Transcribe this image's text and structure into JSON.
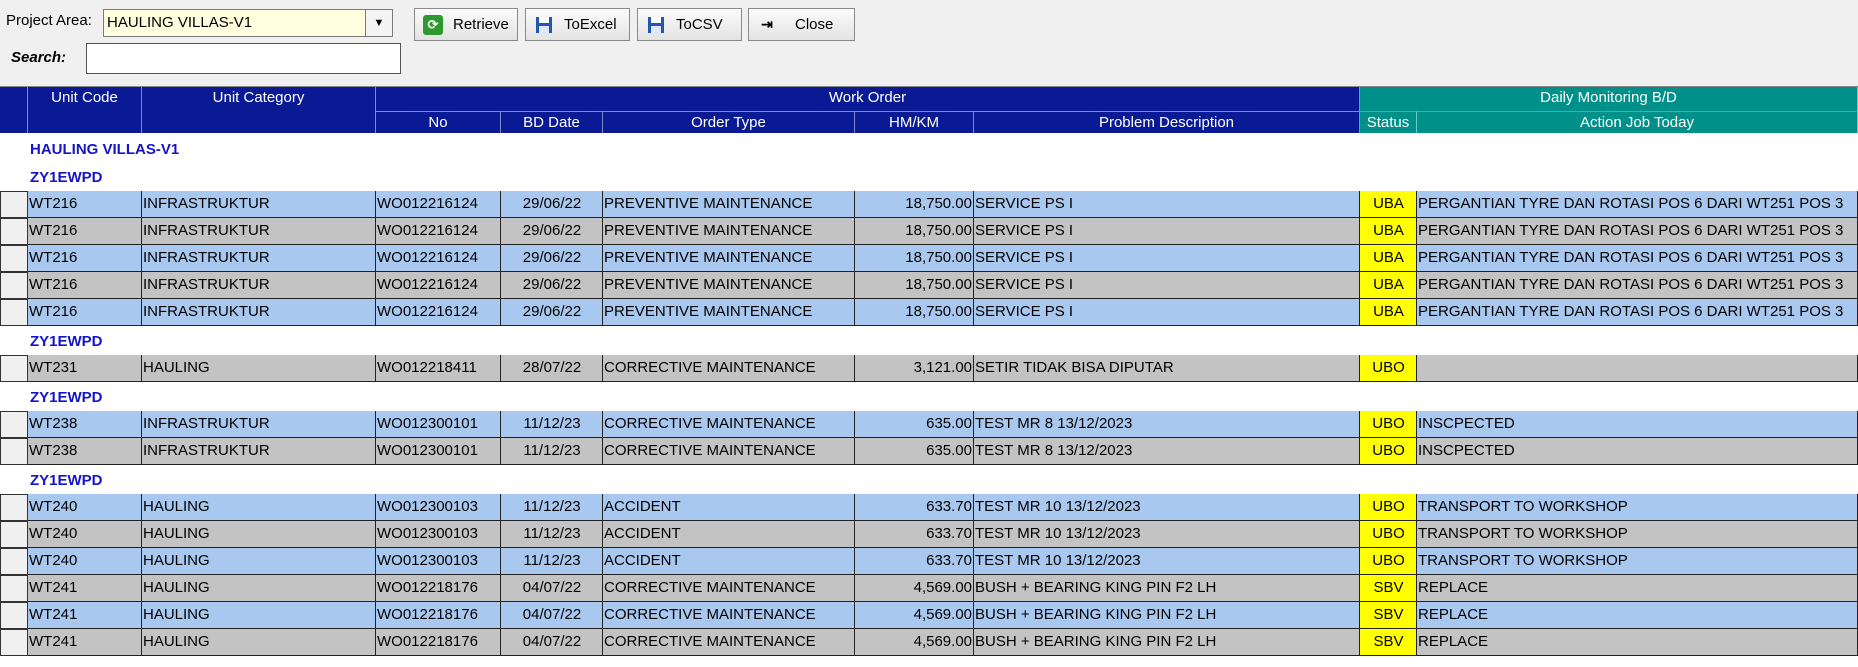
{
  "toolbar": {
    "project_area_label": "Project Area:",
    "project_area_value": "HAULING VILLAS-V1",
    "search_label": "Search:",
    "search_value": "",
    "retrieve_label": "Retrieve",
    "toexcel_label": "ToExcel",
    "tocsv_label": "ToCSV",
    "close_label": "Close"
  },
  "grid": {
    "headers": {
      "unit_code": "Unit Code",
      "unit_category": "Unit Category",
      "work_order": "Work Order",
      "daily_monitoring": "Daily Monitoring B/D",
      "no": "No",
      "bd_date": "BD Date",
      "order_type": "Order Type",
      "hm_km": "HM/KM",
      "problem_description": "Problem Description",
      "status": "Status",
      "action_job_today": "Action Job Today"
    },
    "project_group": "HAULING VILLAS-V1",
    "groups": [
      {
        "label": "ZY1EWPD",
        "rows": [
          {
            "unit": "WT216",
            "cat": "INFRASTRUKTUR",
            "no": "WO012216124",
            "date": "29/06/22",
            "type": "PREVENTIVE MAINTENANCE",
            "hm": "18,750.00",
            "problem": "SERVICE PS I",
            "status": "UBA",
            "action": "PERGANTIAN TYRE DAN ROTASI POS 6 DARI WT251 POS 3"
          },
          {
            "unit": "WT216",
            "cat": "INFRASTRUKTUR",
            "no": "WO012216124",
            "date": "29/06/22",
            "type": "PREVENTIVE MAINTENANCE",
            "hm": "18,750.00",
            "problem": "SERVICE PS I",
            "status": "UBA",
            "action": "PERGANTIAN TYRE DAN ROTASI POS 6 DARI WT251 POS 3"
          },
          {
            "unit": "WT216",
            "cat": "INFRASTRUKTUR",
            "no": "WO012216124",
            "date": "29/06/22",
            "type": "PREVENTIVE MAINTENANCE",
            "hm": "18,750.00",
            "problem": "SERVICE PS I",
            "status": "UBA",
            "action": "PERGANTIAN TYRE DAN ROTASI POS 6 DARI WT251 POS 3"
          },
          {
            "unit": "WT216",
            "cat": "INFRASTRUKTUR",
            "no": "WO012216124",
            "date": "29/06/22",
            "type": "PREVENTIVE MAINTENANCE",
            "hm": "18,750.00",
            "problem": "SERVICE PS I",
            "status": "UBA",
            "action": "PERGANTIAN TYRE DAN ROTASI POS 6 DARI WT251 POS 3"
          },
          {
            "unit": "WT216",
            "cat": "INFRASTRUKTUR",
            "no": "WO012216124",
            "date": "29/06/22",
            "type": "PREVENTIVE MAINTENANCE",
            "hm": "18,750.00",
            "problem": "SERVICE PS I",
            "status": "UBA",
            "action": "PERGANTIAN TYRE DAN ROTASI POS 6 DARI WT251 POS 3"
          }
        ]
      },
      {
        "label": "ZY1EWPD",
        "rows": [
          {
            "unit": "WT231",
            "cat": "HAULING",
            "no": "WO012218411",
            "date": "28/07/22",
            "type": "CORRECTIVE MAINTENANCE",
            "hm": "3,121.00",
            "problem": "SETIR TIDAK BISA DIPUTAR",
            "status": "UBO",
            "action": ""
          }
        ]
      },
      {
        "label": "ZY1EWPD",
        "rows": [
          {
            "unit": "WT238",
            "cat": "INFRASTRUKTUR",
            "no": "WO012300101",
            "date": "11/12/23",
            "type": "CORRECTIVE MAINTENANCE",
            "hm": "635.00",
            "problem": "TEST MR 8 13/12/2023",
            "status": "UBO",
            "action": "INSCPECTED"
          },
          {
            "unit": "WT238",
            "cat": "INFRASTRUKTUR",
            "no": "WO012300101",
            "date": "11/12/23",
            "type": "CORRECTIVE MAINTENANCE",
            "hm": "635.00",
            "problem": "TEST MR 8 13/12/2023",
            "status": "UBO",
            "action": "INSCPECTED"
          }
        ]
      },
      {
        "label": "ZY1EWPD",
        "rows": [
          {
            "unit": "WT240",
            "cat": "HAULING",
            "no": "WO012300103",
            "date": "11/12/23",
            "type": "ACCIDENT",
            "hm": "633.70",
            "problem": "TEST MR 10 13/12/2023",
            "status": "UBO",
            "action": "TRANSPORT TO WORKSHOP"
          },
          {
            "unit": "WT240",
            "cat": "HAULING",
            "no": "WO012300103",
            "date": "11/12/23",
            "type": "ACCIDENT",
            "hm": "633.70",
            "problem": "TEST MR 10 13/12/2023",
            "status": "UBO",
            "action": "TRANSPORT TO WORKSHOP"
          },
          {
            "unit": "WT240",
            "cat": "HAULING",
            "no": "WO012300103",
            "date": "11/12/23",
            "type": "ACCIDENT",
            "hm": "633.70",
            "problem": "TEST MR 10 13/12/2023",
            "status": "UBO",
            "action": "TRANSPORT TO WORKSHOP"
          },
          {
            "unit": "WT241",
            "cat": "HAULING",
            "no": "WO012218176",
            "date": "04/07/22",
            "type": "CORRECTIVE MAINTENANCE",
            "hm": "4,569.00",
            "problem": "BUSH + BEARING KING PIN F2 LH",
            "status": "SBV",
            "action": "REPLACE"
          },
          {
            "unit": "WT241",
            "cat": "HAULING",
            "no": "WO012218176",
            "date": "04/07/22",
            "type": "CORRECTIVE MAINTENANCE",
            "hm": "4,569.00",
            "problem": "BUSH + BEARING KING PIN F2 LH",
            "status": "SBV",
            "action": "REPLACE"
          },
          {
            "unit": "WT241",
            "cat": "HAULING",
            "no": "WO012218176",
            "date": "04/07/22",
            "type": "CORRECTIVE MAINTENANCE",
            "hm": "4,569.00",
            "problem": "BUSH + BEARING KING PIN F2 LH",
            "status": "SBV",
            "action": "REPLACE"
          }
        ]
      }
    ]
  },
  "colors": {
    "header_blue": "#0a1a94",
    "header_teal": "#00908a",
    "row_blue": "#a9c8ef",
    "row_gray": "#c3c3c3",
    "status_yellow": "#ffff00",
    "group_text": "#1515c8"
  },
  "icons": {
    "retrieve": "refresh-icon",
    "toexcel": "save-disk-icon",
    "tocsv": "save-disk-icon",
    "close": "exit-icon",
    "dropdown": "chevron-down-icon"
  }
}
